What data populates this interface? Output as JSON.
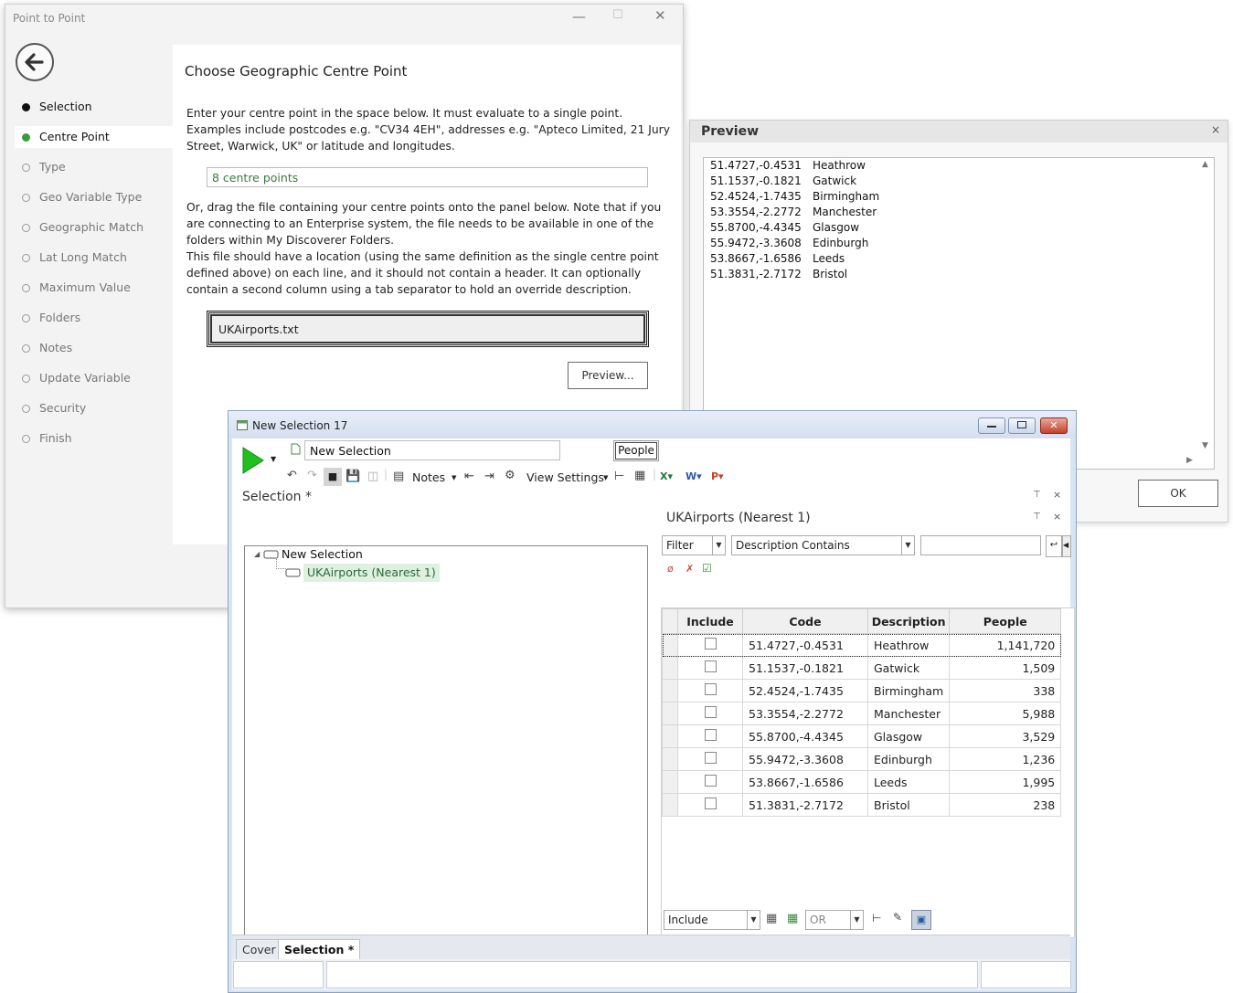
{
  "p2p": {
    "title": "Point to Point",
    "heading": "Choose Geographic Centre Point",
    "nav": [
      {
        "label": "Selection",
        "state": "done"
      },
      {
        "label": "Centre Point",
        "state": "active"
      },
      {
        "label": "Type",
        "state": "pending"
      },
      {
        "label": "Geo Variable Type",
        "state": "pending"
      },
      {
        "label": "Geographic Match",
        "state": "pending"
      },
      {
        "label": "Lat Long Match",
        "state": "pending"
      },
      {
        "label": "Maximum Value",
        "state": "pending"
      },
      {
        "label": "Folders",
        "state": "pending"
      },
      {
        "label": "Notes",
        "state": "pending"
      },
      {
        "label": "Update Variable",
        "state": "pending"
      },
      {
        "label": "Security",
        "state": "pending"
      },
      {
        "label": "Finish",
        "state": "pending"
      }
    ],
    "intro": [
      "Enter your centre point in the space below.  It must evaluate to a single point.",
      "Examples include postcodes e.g. \"CV34 4EH\", addresses e.g. \"Apteco Limited, 21 Jury",
      "Street, Warwick, UK\" or latitude and longitudes."
    ],
    "centre_input": "8 centre points",
    "drag_text": [
      "Or, drag the file containing your centre points onto the panel below. Note that if you",
      "are connecting to an Enterprise system, the file needs to be available in one of the",
      "folders within My Discoverer Folders.",
      "This file should have a location (using the same definition as the single centre point",
      "defined above) on each line, and it should not contain a header.  It can optionally",
      "contain a second column using a tab separator to hold an override description."
    ],
    "file_name": "UKAirports.txt",
    "preview_button": "Preview..."
  },
  "preview": {
    "title": "Preview",
    "ok_button": "OK",
    "rows": [
      {
        "coord": "51.4727,-0.4531",
        "name": "Heathrow"
      },
      {
        "coord": "51.1537,-0.1821",
        "name": "Gatwick"
      },
      {
        "coord": "52.4524,-1.7435",
        "name": "Birmingham"
      },
      {
        "coord": "53.3554,-2.2772",
        "name": "Manchester"
      },
      {
        "coord": "55.8700,-4.4345",
        "name": "Glasgow"
      },
      {
        "coord": "55.9472,-3.3608",
        "name": "Edinburgh"
      },
      {
        "coord": "53.8667,-1.6586",
        "name": "Leeds"
      },
      {
        "coord": "51.3831,-2.7172",
        "name": "Bristol"
      }
    ]
  },
  "selwin": {
    "title": "New Selection 17",
    "name_input": "New Selection",
    "people_button": "People",
    "notes_label": "Notes",
    "view_settings_label": "View Settings",
    "selection_label": "Selection *",
    "tree_root": "New Selection",
    "tree_child": "UKAirports (Nearest 1)",
    "panel_title": "UKAirports (Nearest 1)",
    "filter_combo": "Filter",
    "desc_combo": "Description Contains",
    "columns": [
      "Include",
      "Code",
      "Description",
      "People"
    ],
    "rows": [
      {
        "code": "51.4727,-0.4531",
        "desc": "Heathrow",
        "people": "1,141,720"
      },
      {
        "code": "51.1537,-0.1821",
        "desc": "Gatwick",
        "people": "1,509"
      },
      {
        "code": "52.4524,-1.7435",
        "desc": "Birmingham",
        "people": "338"
      },
      {
        "code": "53.3554,-2.2772",
        "desc": "Manchester",
        "people": "5,988"
      },
      {
        "code": "55.8700,-4.4345",
        "desc": "Glasgow",
        "people": "3,529"
      },
      {
        "code": "55.9472,-3.3608",
        "desc": "Edinburgh",
        "people": "1,236"
      },
      {
        "code": "53.8667,-1.6586",
        "desc": "Leeds",
        "people": "1,995"
      },
      {
        "code": "51.3831,-2.7172",
        "desc": "Bristol",
        "people": "238"
      }
    ],
    "include_combo": "Include",
    "or_combo": "OR",
    "tabs": [
      "Cover",
      "Selection *"
    ]
  }
}
